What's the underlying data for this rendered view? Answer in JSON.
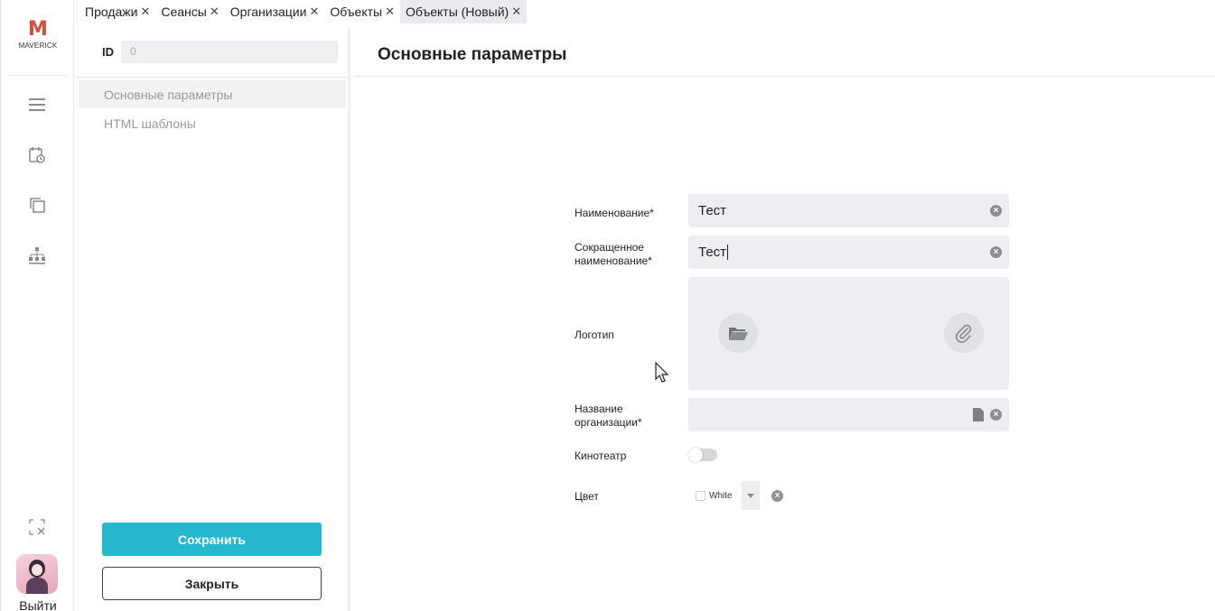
{
  "app": {
    "brand_letter": "M",
    "brand_name": "MAVERICK",
    "logout_label": "Выйти"
  },
  "tabs": [
    {
      "label": "Продажи",
      "close": "✕",
      "active": false
    },
    {
      "label": "Сеансы",
      "close": "✕",
      "active": false
    },
    {
      "label": "Организации",
      "close": "✕",
      "active": false
    },
    {
      "label": "Объекты",
      "close": "✕",
      "active": false
    },
    {
      "label": "Объекты (Новый)",
      "close": "✕",
      "active": true
    }
  ],
  "sidebar": {
    "id_label": "ID",
    "id_value": "0",
    "items": [
      {
        "label": "Основные параметры",
        "active": true
      },
      {
        "label": "HTML шаблоны",
        "active": false
      }
    ],
    "save_label": "Сохранить",
    "close_label": "Закрыть"
  },
  "main": {
    "title": "Основные параметры",
    "fields": {
      "name_label": "Наименование*",
      "name_value": "Тест",
      "short_name_label_1": "Сокращенное",
      "short_name_label_2": "наименование*",
      "short_name_value": "Тест",
      "logo_label": "Логотип",
      "org_label_1": "Название",
      "org_label_2": "организации*",
      "org_value": "",
      "cinema_label": "Кинотеатр",
      "cinema_enabled": false,
      "color_label": "Цвет",
      "color_value": "White"
    }
  },
  "colors": {
    "accent": "#26b8ce",
    "input_bg": "#eceef1"
  },
  "icons": [
    "menu-icon",
    "calendar-clock-icon",
    "copy-icon",
    "hierarchy-icon",
    "collapse-icon",
    "folder-icon",
    "paperclip-icon",
    "file-icon",
    "clear-icon",
    "chevron-down-icon"
  ]
}
